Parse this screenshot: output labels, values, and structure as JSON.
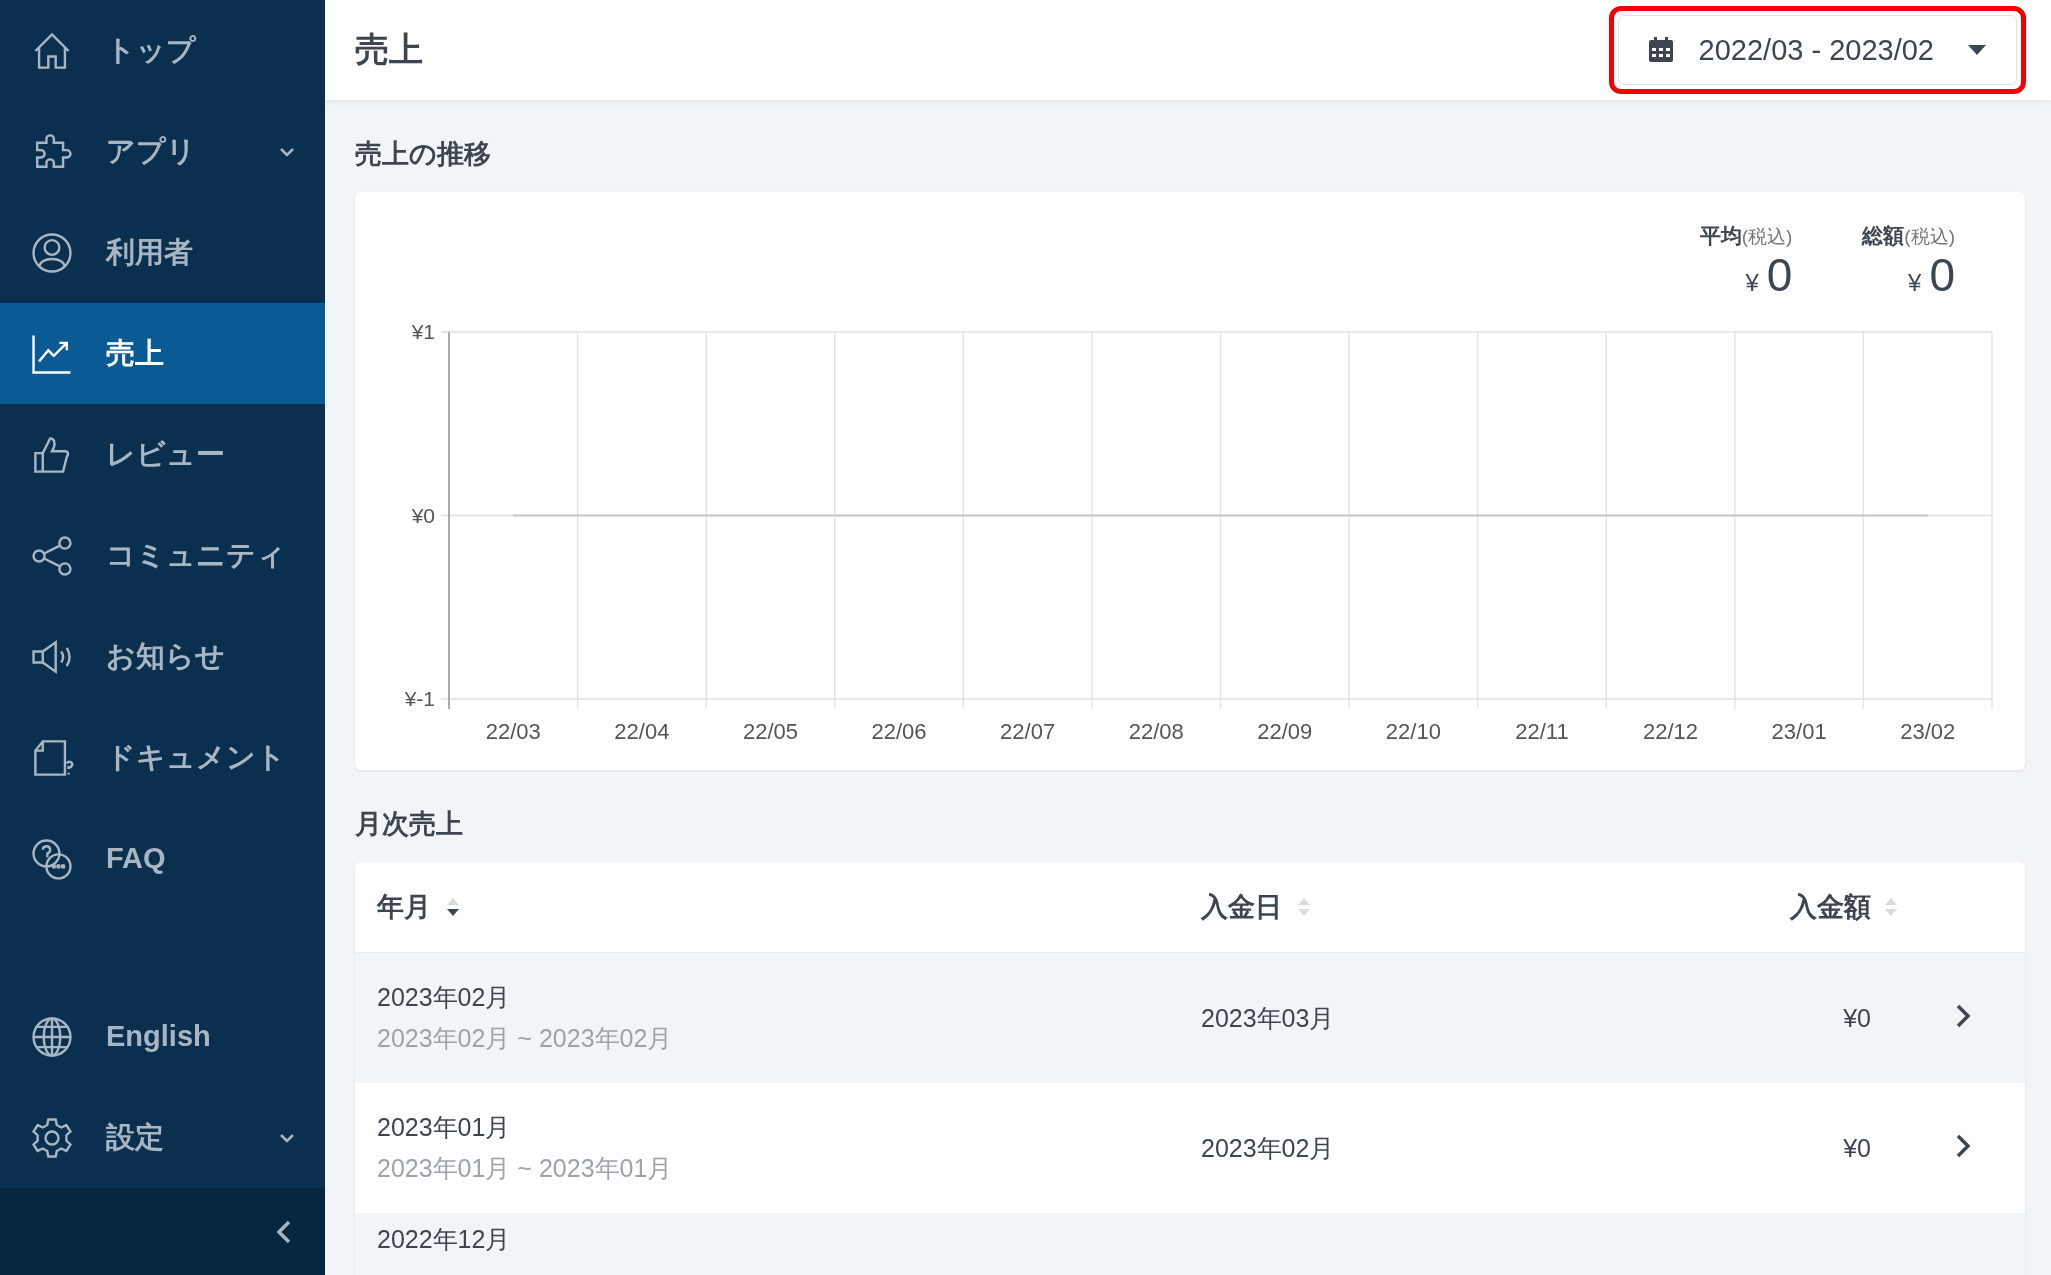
{
  "sidebar": {
    "items": [
      {
        "label": "トップ",
        "kind": "home",
        "selected": false
      },
      {
        "label": "アプリ",
        "kind": "apps",
        "selected": false,
        "expanded": false
      },
      {
        "label": "利用者",
        "kind": "users",
        "selected": false
      },
      {
        "label": "売上",
        "kind": "sales",
        "selected": true
      },
      {
        "label": "レビュー",
        "kind": "reviews",
        "selected": false
      },
      {
        "label": "コミュニティ",
        "kind": "community",
        "selected": false
      },
      {
        "label": "お知らせ",
        "kind": "news",
        "selected": false
      },
      {
        "label": "ドキュメント",
        "kind": "docs",
        "selected": false
      },
      {
        "label": "FAQ",
        "kind": "faq",
        "selected": false
      }
    ],
    "bottom_items": [
      {
        "label": "English",
        "kind": "language",
        "selected": false
      },
      {
        "label": "設定",
        "kind": "settings",
        "selected": false,
        "expanded": false
      }
    ]
  },
  "header": {
    "title": "売上",
    "date_range": "2022/03 - 2023/02"
  },
  "trend": {
    "title": "売上の推移",
    "summary": [
      {
        "label": "平均",
        "note": "(税込)",
        "currency": "¥",
        "value": "0"
      },
      {
        "label": "総額",
        "note": "(税込)",
        "currency": "¥",
        "value": "0"
      }
    ],
    "chart_data": {
      "type": "line",
      "categories": [
        "22/03",
        "22/04",
        "22/05",
        "22/06",
        "22/07",
        "22/08",
        "22/09",
        "22/10",
        "22/11",
        "22/12",
        "23/01",
        "23/02"
      ],
      "ylim": [
        -1,
        1
      ],
      "yticks": [
        {
          "value": 1,
          "label": "¥1"
        },
        {
          "value": 0,
          "label": "¥0"
        },
        {
          "value": -1,
          "label": "¥-1"
        }
      ],
      "series": [
        {
          "color": "#c8c8c8",
          "values": [
            0,
            0,
            0,
            0,
            0,
            0,
            0,
            0,
            0,
            0,
            0,
            0
          ]
        }
      ]
    }
  },
  "monthly": {
    "title": "月次売上",
    "columns": [
      {
        "label": "年月",
        "sorted": true
      },
      {
        "label": "入金日",
        "sorted": false
      },
      {
        "label": "入金額",
        "sorted": false
      }
    ],
    "rows": [
      {
        "month": "2023年02月",
        "range": "2023年02月 ~ 2023年02月",
        "paid": "2023年03月",
        "amount": "¥0"
      },
      {
        "month": "2023年01月",
        "range": "2023年01月 ~ 2023年01月",
        "paid": "2023年02月",
        "amount": "¥0"
      },
      {
        "month": "2022年12月"
      }
    ]
  }
}
